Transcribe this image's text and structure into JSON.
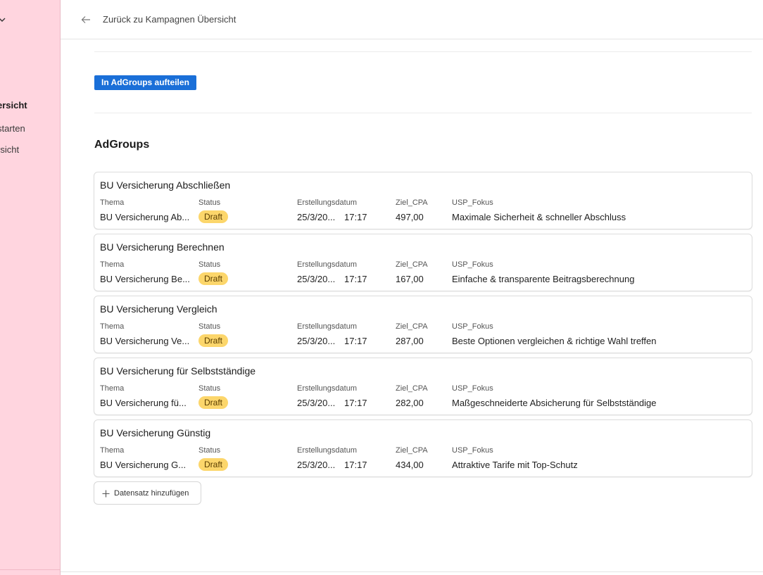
{
  "sidebar": {
    "items": [
      {
        "label": "ersicht",
        "active": true
      },
      {
        "label": " starten",
        "active": false
      },
      {
        "label": "rsicht",
        "active": false
      }
    ]
  },
  "header": {
    "back_label": "Zurück zu Kampagnen Übersicht"
  },
  "actions": {
    "split_button": "In AdGroups aufteilen"
  },
  "section": {
    "title": "AdGroups"
  },
  "columns": {
    "thema": "Thema",
    "status": "Status",
    "date": "Erstellungsdatum",
    "cpa": "Ziel_CPA",
    "usp": "USP_Fokus"
  },
  "adgroups": [
    {
      "title": "BU Versicherung Abschließen",
      "thema": "BU Versicherung Ab...",
      "status": "Draft",
      "date": "25/3/20...",
      "time": "17:17",
      "cpa": "497,00",
      "usp": "Maximale Sicherheit & schneller Abschluss"
    },
    {
      "title": "BU Versicherung Berechnen",
      "thema": "BU Versicherung Be...",
      "status": "Draft",
      "date": "25/3/20...",
      "time": "17:17",
      "cpa": "167,00",
      "usp": "Einfache & transparente Beitragsberechnung"
    },
    {
      "title": "BU Versicherung Vergleich",
      "thema": "BU Versicherung Ve...",
      "status": "Draft",
      "date": "25/3/20...",
      "time": "17:17",
      "cpa": "287,00",
      "usp": "Beste Optionen vergleichen & richtige Wahl treffen"
    },
    {
      "title": "BU Versicherung für Selbstständige",
      "thema": "BU Versicherung fü...",
      "status": "Draft",
      "date": "25/3/20...",
      "time": "17:17",
      "cpa": "282,00",
      "usp": "Maßgeschneiderte Absicherung für Selbstständige"
    },
    {
      "title": "BU Versicherung Günstig",
      "thema": "BU Versicherung G...",
      "status": "Draft",
      "date": "25/3/20...",
      "time": "17:17",
      "cpa": "434,00",
      "usp": "Attraktive Tarife mit Top-Schutz"
    }
  ],
  "add_record": {
    "label": "Datensatz hinzufügen"
  },
  "colors": {
    "sidebar_bg": "#ffd5df",
    "primary": "#1a6fd8",
    "badge_draft": "#fcd66b"
  }
}
